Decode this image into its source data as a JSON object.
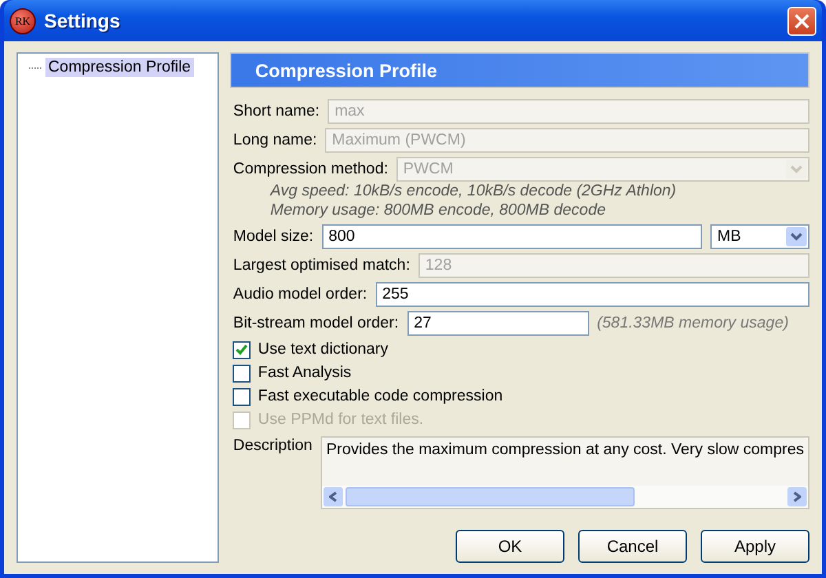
{
  "window": {
    "title": "Settings",
    "logo": "RK"
  },
  "tree": [
    {
      "label": "Compression Profile",
      "selected": true
    }
  ],
  "panel_title": "Compression Profile",
  "fields": [
    {
      "kind": "text",
      "label": "Short name:",
      "value": "max",
      "disabled": true
    },
    {
      "kind": "text",
      "label": "Long name:",
      "value": "Maximum (PWCM)",
      "disabled": true
    },
    {
      "kind": "select",
      "label": "Compression method:",
      "value": "PWCM",
      "disabled": true
    },
    {
      "kind": "note",
      "text": "Avg speed: 10kB/s encode, 10kB/s decode (2GHz Athlon)"
    },
    {
      "kind": "note",
      "text": "Memory usage: 800MB encode, 800MB decode"
    },
    {
      "kind": "text_unit",
      "label": "Model size:",
      "value": "800",
      "unit": "MB",
      "disabled": false
    },
    {
      "kind": "text",
      "label": "Largest optimised match:",
      "value": "128",
      "disabled": true
    },
    {
      "kind": "text",
      "label": "Audio model order:",
      "value": "255",
      "disabled": false
    },
    {
      "kind": "text_hint",
      "label": "Bit-stream model order:",
      "value": "27",
      "hint": "(581.33MB memory usage)",
      "disabled": false
    }
  ],
  "options": [
    {
      "label": "Use text dictionary",
      "checked": true,
      "disabled": false
    },
    {
      "label": "Fast Analysis",
      "checked": false,
      "disabled": false
    },
    {
      "label": "Fast executable code compression",
      "checked": false,
      "disabled": false
    },
    {
      "label": "Use PPMd for text files.",
      "checked": false,
      "disabled": true
    }
  ],
  "description": {
    "label": "Description",
    "text": "Provides the maximum compression at any cost. Very slow compres"
  },
  "buttons": [
    "OK",
    "Cancel",
    "Apply"
  ]
}
